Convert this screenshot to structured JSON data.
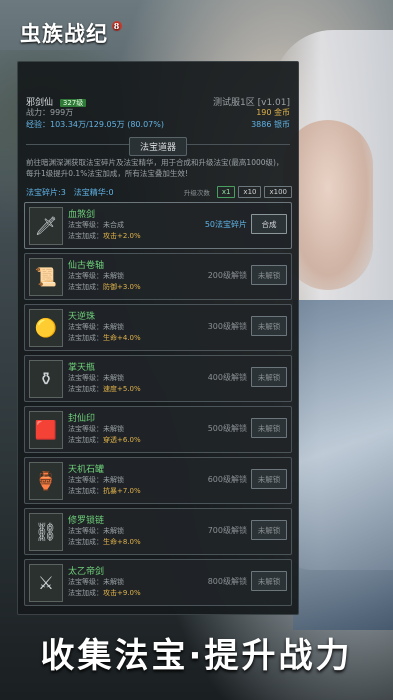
{
  "app": {
    "logo": "虫族战纪",
    "logo_badge": "8"
  },
  "player": {
    "name": "邪剑仙",
    "level": "327级",
    "server": "测试服1区 [v1.01]",
    "power_label": "战力：",
    "power": "999万",
    "gold": "190 金币",
    "exp_label": "经验：",
    "exp": "103.34万/129.05万 (80.07%)",
    "silver": "3886 银币"
  },
  "panel": {
    "title": "法宝道器",
    "description": "前往暗渊深渊获取法宝碎片及法宝精华，用于合成和升级法宝(最高1000级)，每升1级提升0.1%法宝加成，所有法宝叠加生效!",
    "shards_label": "法宝碎片:3",
    "essence_label": "法宝精华:0",
    "upgrade_label": "升级次数",
    "multipliers": [
      "x1",
      "x10",
      "x100"
    ]
  },
  "treasures": [
    {
      "name": "血煞剑",
      "lv": "法宝等级：未合成",
      "bonus_label": "法宝加成：",
      "bonus": "攻击+2.0%",
      "req": "50法宝碎片",
      "btn": "合成",
      "icon": "sword-icon",
      "glyph": "🗡"
    },
    {
      "name": "仙古卷轴",
      "lv": "法宝等级：未解锁",
      "bonus_label": "法宝加成：",
      "bonus": "防御+3.0%",
      "req": "200级解锁",
      "btn": "未解锁",
      "icon": "scroll-icon",
      "glyph": "📜"
    },
    {
      "name": "天逆珠",
      "lv": "法宝等级：未解锁",
      "bonus_label": "法宝加成：",
      "bonus": "生命+4.0%",
      "req": "300级解锁",
      "btn": "未解锁",
      "icon": "orb-icon",
      "glyph": "🟡"
    },
    {
      "name": "掌天瓶",
      "lv": "法宝等级：未解锁",
      "bonus_label": "法宝加成：",
      "bonus": "速度+5.0%",
      "req": "400级解锁",
      "btn": "未解锁",
      "icon": "bottle-icon",
      "glyph": "⚱"
    },
    {
      "name": "封仙印",
      "lv": "法宝等级：未解锁",
      "bonus_label": "法宝加成：",
      "bonus": "穿透+6.0%",
      "req": "500级解锁",
      "btn": "未解锁",
      "icon": "seal-icon",
      "glyph": "🟥"
    },
    {
      "name": "天机石罐",
      "lv": "法宝等级：未解锁",
      "bonus_label": "法宝加成：",
      "bonus": "抗暴+7.0%",
      "req": "600级解锁",
      "btn": "未解锁",
      "icon": "jar-icon",
      "glyph": "🏺"
    },
    {
      "name": "修罗锁链",
      "lv": "法宝等级：未解锁",
      "bonus_label": "法宝加成：",
      "bonus": "生命+8.0%",
      "req": "700级解锁",
      "btn": "未解锁",
      "icon": "chain-icon",
      "glyph": "⛓"
    },
    {
      "name": "太乙帝剑",
      "lv": "法宝等级：未解锁",
      "bonus_label": "法宝加成：",
      "bonus": "攻击+9.0%",
      "req": "800级解锁",
      "btn": "未解锁",
      "icon": "emperor-sword-icon",
      "glyph": "⚔"
    }
  ],
  "caption": "收集法宝·提升战力"
}
